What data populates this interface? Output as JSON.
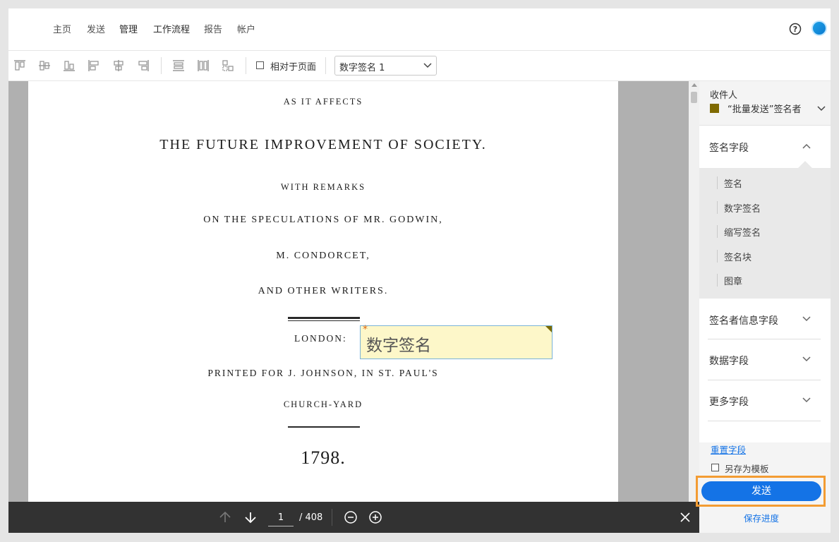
{
  "nav": {
    "items": [
      "主页",
      "发送",
      "管理",
      "工作流程",
      "报告",
      "帐户"
    ]
  },
  "toolbar": {
    "relative_to_page_label": "相对于页面",
    "field_select_value": "数字签名 1"
  },
  "document": {
    "lines": [
      "AS IT AFFECTS",
      "THE FUTURE IMPROVEMENT OF SOCIETY.",
      "WITH REMARKS",
      "ON THE SPECULATIONS OF MR. GODWIN,",
      "M. CONDORCET,",
      "AND OTHER WRITERS."
    ],
    "london": "LONDON:",
    "printed_for": "PRINTED FOR J. JOHNSON, IN ST. PAUL'S",
    "churchyard": "CHURCH-YARD",
    "year": "1798.",
    "signature_field_label": "数字签名",
    "required_marker": "*"
  },
  "pager": {
    "current_page": "1",
    "total_pages": "/ 408"
  },
  "panel": {
    "recipient_title": "收件人",
    "recipient_name": "“批量发送”签名者",
    "recipient_color": "#7f6a00",
    "sections": {
      "signature_fields": "签名字段",
      "signer_info_fields": "签名者信息字段",
      "data_fields": "数据字段",
      "more_fields": "更多字段"
    },
    "signature_items": [
      "签名",
      "数字签名",
      "缩写签名",
      "签名块",
      "图章"
    ],
    "reset_fields": "重置字段",
    "save_as_template": "另存为模板",
    "send": "发送",
    "save_progress": "保存进度"
  },
  "colors": {
    "accent": "#1473e6",
    "highlight_outline": "#f39c33"
  }
}
